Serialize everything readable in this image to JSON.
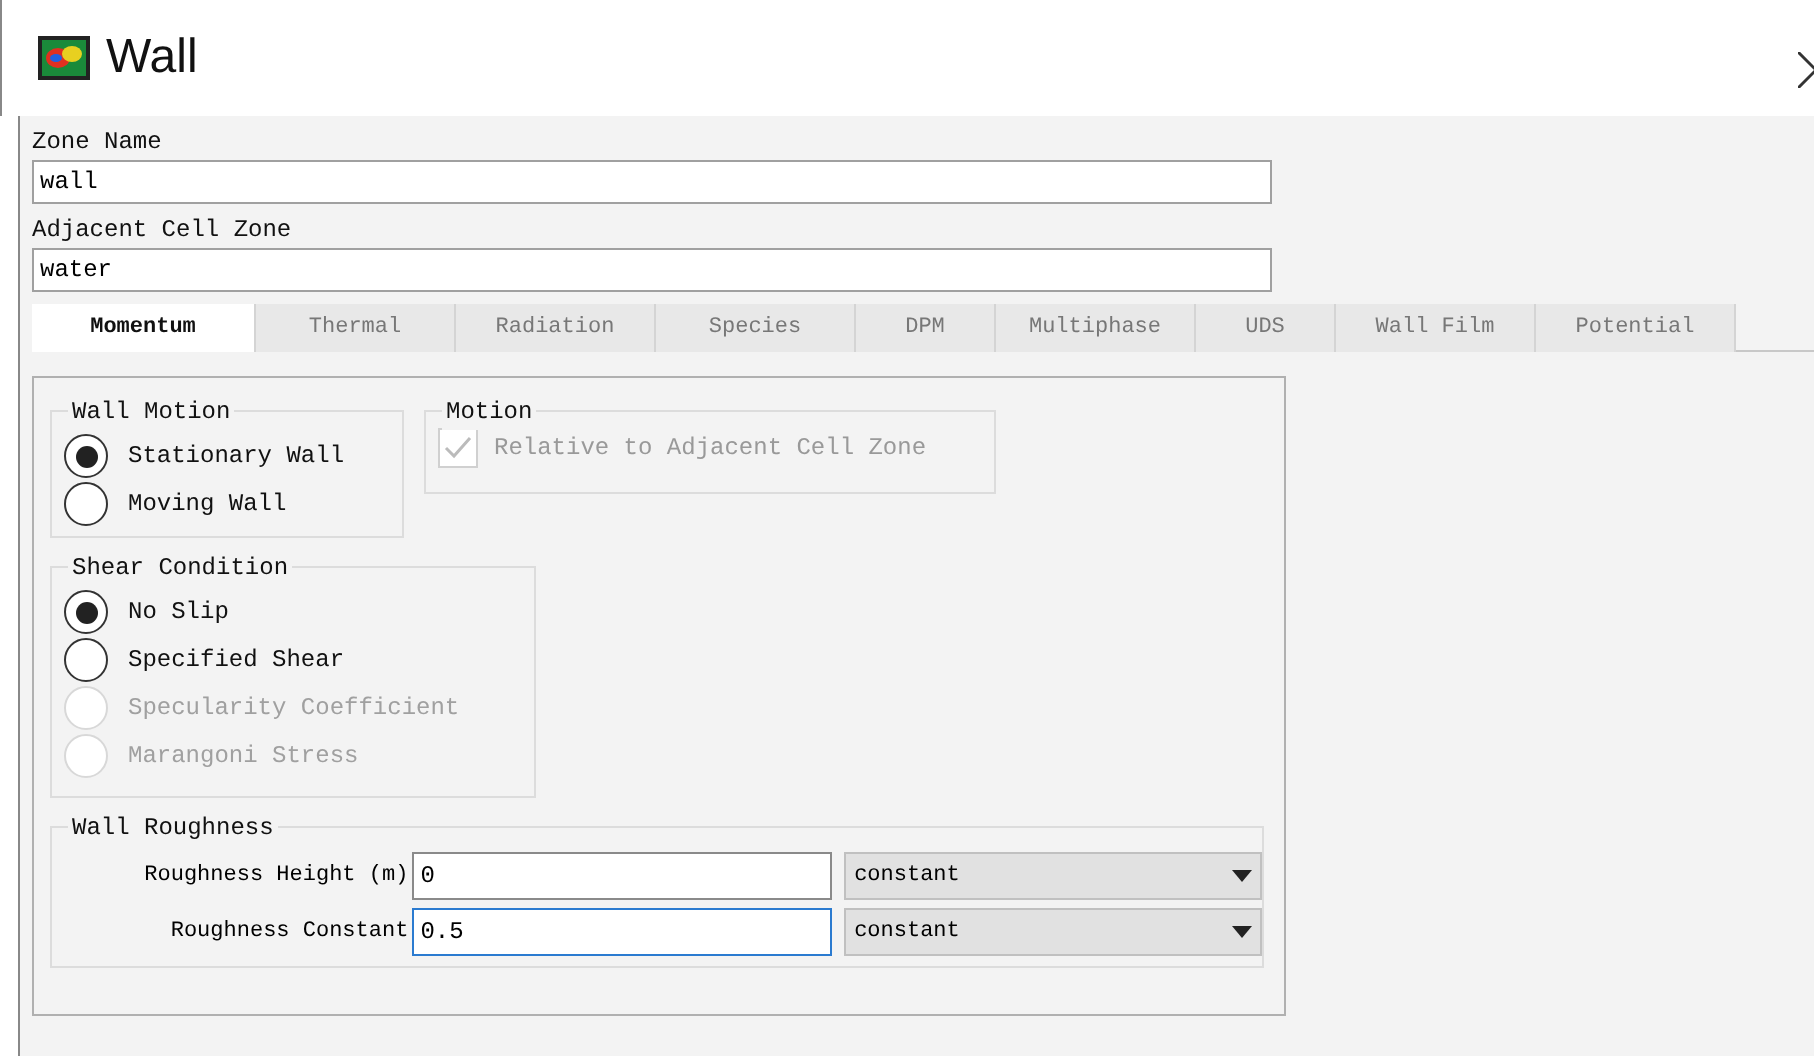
{
  "window": {
    "title": "Wall"
  },
  "zone_name": {
    "label": "Zone Name",
    "value": "wall"
  },
  "adjacent_cell_zone": {
    "label": "Adjacent Cell Zone",
    "value": "water"
  },
  "tabs": [
    {
      "label": "Momentum",
      "selected": true
    },
    {
      "label": "Thermal",
      "selected": false
    },
    {
      "label": "Radiation",
      "selected": false
    },
    {
      "label": "Species",
      "selected": false
    },
    {
      "label": "DPM",
      "selected": false
    },
    {
      "label": "Multiphase",
      "selected": false
    },
    {
      "label": "UDS",
      "selected": false
    },
    {
      "label": "Wall Film",
      "selected": false
    },
    {
      "label": "Potential",
      "selected": false
    }
  ],
  "wall_motion": {
    "title": "Wall Motion",
    "options": [
      {
        "label": "Stationary Wall",
        "selected": true,
        "disabled": false
      },
      {
        "label": "Moving Wall",
        "selected": false,
        "disabled": false
      }
    ]
  },
  "motion": {
    "title": "Motion",
    "checkbox": {
      "label": "Relative to Adjacent Cell Zone",
      "checked": true,
      "disabled": true
    }
  },
  "shear_condition": {
    "title": "Shear Condition",
    "options": [
      {
        "label": "No Slip",
        "selected": true,
        "disabled": false
      },
      {
        "label": "Specified Shear",
        "selected": false,
        "disabled": false
      },
      {
        "label": "Specularity Coefficient",
        "selected": false,
        "disabled": true
      },
      {
        "label": "Marangoni Stress",
        "selected": false,
        "disabled": true
      }
    ]
  },
  "wall_roughness": {
    "title": "Wall Roughness",
    "rows": [
      {
        "label": "Roughness Height (m)",
        "value": "0",
        "method": "constant",
        "focused": false
      },
      {
        "label": "Roughness Constant",
        "value": "0.5",
        "method": "constant",
        "focused": true
      }
    ]
  }
}
